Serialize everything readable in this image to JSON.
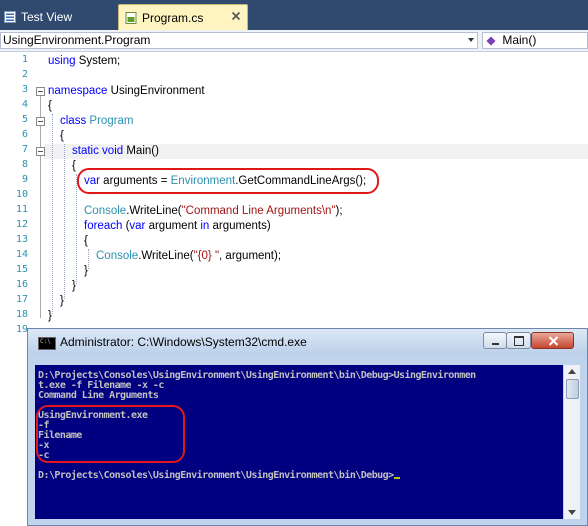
{
  "tabs": [
    {
      "label": "Test View",
      "active": false
    },
    {
      "label": "Program.cs",
      "active": true
    }
  ],
  "navbar": {
    "type_combo": "UsingEnvironment.Program",
    "member_combo": "Main()"
  },
  "editor": {
    "line_numbers": [
      "1",
      "2",
      "3",
      "4",
      "5",
      "6",
      "7",
      "8",
      "9",
      "10",
      "11",
      "12",
      "13",
      "14",
      "15",
      "16",
      "17",
      "18",
      "19"
    ],
    "lines": {
      "l1": [
        {
          "t": "using ",
          "c": "kw"
        },
        {
          "t": "System;",
          "c": ""
        }
      ],
      "l3": [
        {
          "t": "namespace ",
          "c": "kw"
        },
        {
          "t": "UsingEnvironment",
          "c": ""
        }
      ],
      "l4": [
        {
          "t": "{",
          "c": ""
        }
      ],
      "l5": [
        {
          "t": "class ",
          "c": "kw"
        },
        {
          "t": "Program",
          "c": "ty"
        }
      ],
      "l6": [
        {
          "t": "{",
          "c": ""
        }
      ],
      "l7": [
        {
          "t": "static ",
          "c": "kw"
        },
        {
          "t": "void ",
          "c": "kw"
        },
        {
          "t": "Main()",
          "c": ""
        }
      ],
      "l8": [
        {
          "t": "{",
          "c": ""
        }
      ],
      "l9": [
        {
          "t": "var ",
          "c": "kw"
        },
        {
          "t": "arguments = ",
          "c": ""
        },
        {
          "t": "Environment",
          "c": "ty"
        },
        {
          "t": ".GetCommandLineArgs();",
          "c": ""
        }
      ],
      "l11": [
        {
          "t": "Console",
          "c": "ty"
        },
        {
          "t": ".WriteLine(",
          "c": ""
        },
        {
          "t": "\"Command Line Arguments\\n\"",
          "c": "st"
        },
        {
          "t": ");",
          "c": ""
        }
      ],
      "l12": [
        {
          "t": "foreach ",
          "c": "kw"
        },
        {
          "t": "(",
          "c": ""
        },
        {
          "t": "var ",
          "c": "kw"
        },
        {
          "t": "argument ",
          "c": ""
        },
        {
          "t": "in ",
          "c": "kw"
        },
        {
          "t": "arguments)",
          "c": ""
        }
      ],
      "l13": [
        {
          "t": "{",
          "c": ""
        }
      ],
      "l14": [
        {
          "t": "Console",
          "c": "ty"
        },
        {
          "t": ".WriteLine(",
          "c": ""
        },
        {
          "t": "\"{0} \"",
          "c": "st"
        },
        {
          "t": ", argument);",
          "c": ""
        }
      ],
      "l15": [
        {
          "t": "}",
          "c": ""
        }
      ],
      "l16": [
        {
          "t": "}",
          "c": ""
        }
      ],
      "l17": [
        {
          "t": "}",
          "c": ""
        }
      ],
      "l18": [
        {
          "t": "}",
          "c": ""
        }
      ]
    }
  },
  "console": {
    "title": "Administrator: C:\\Windows\\System32\\cmd.exe",
    "lines": [
      "D:\\Projects\\Consoles\\UsingEnvironment\\UsingEnvironment\\bin\\Debug>UsingEnvironmen",
      "t.exe -f Filename -x -c",
      "Command Line Arguments",
      "",
      "UsingEnvironment.exe",
      "-f",
      "Filename",
      "-x",
      "-c",
      "",
      "D:\\Projects\\Consoles\\UsingEnvironment\\UsingEnvironment\\bin\\Debug>"
    ]
  },
  "colors": {
    "tab_strip": "#2f4a6e",
    "active_tab": "#fdf4bf",
    "console_bg": "#000080",
    "console_text": "#c0c0c0",
    "highlight_oval": "#e01818"
  },
  "icons": [
    "test-view-icon",
    "csharp-file-icon",
    "tab-close-icon",
    "dropdown-arrow-icon",
    "method-icon",
    "cmd-icon",
    "minimize-icon",
    "maximize-icon",
    "close-icon",
    "scroll-up-icon",
    "scroll-down-icon"
  ]
}
